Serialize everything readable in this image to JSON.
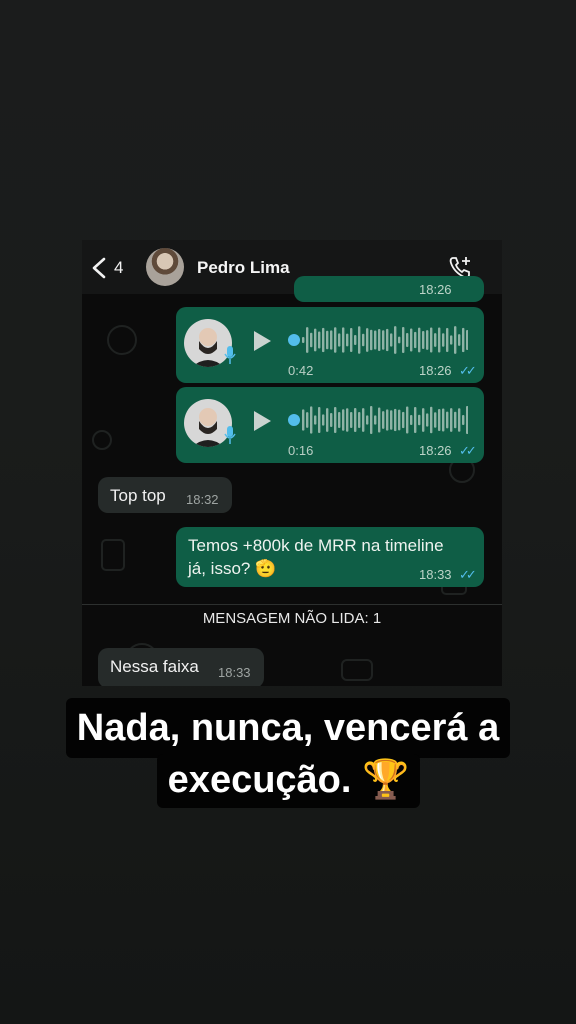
{
  "header": {
    "back_count": "4",
    "contact_name": "Pedro Lima"
  },
  "messages": {
    "partial_time": "18:26",
    "voice1": {
      "duration": "0:42",
      "time": "18:26",
      "ticks": "✓✓"
    },
    "voice2": {
      "duration": "0:16",
      "time": "18:26",
      "ticks": "✓✓"
    },
    "in1": {
      "text": "Top top",
      "time": "18:32"
    },
    "out1": {
      "line1": "Temos +800k de MRR na timeline",
      "line2": "já, isso? 🫡",
      "time": "18:33",
      "ticks": "✓✓"
    },
    "unread_label": "MENSAGEM NÃO LIDA: 1",
    "in2": {
      "text": "Nessa faixa",
      "time": "18:33"
    }
  },
  "caption": {
    "line1": "Nada, nunca, vencerá a",
    "line2": "execução. 🏆"
  },
  "colors": {
    "outgoing": "#0f5e46",
    "incoming": "#262b2a",
    "read_ticks": "#53bdeb",
    "page_bg": "#1b1c1c"
  }
}
